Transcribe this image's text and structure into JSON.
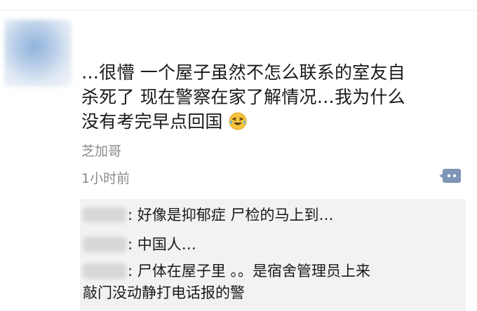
{
  "post": {
    "text_lines": [
      "…很懵 一个屋子虽然不怎么联系的室友自",
      "杀死了 现在警察在家了解情况…我为什么",
      "没有考完早点回国"
    ],
    "emoji": "laughing-crying-emoji",
    "author": "芝加哥",
    "time": "1小时前"
  },
  "replies": [
    {
      "colon": ":",
      "text": "好像是抑郁症 尸检的马上到…"
    },
    {
      "colon": ":",
      "text": "中国人…"
    },
    {
      "colon": ":",
      "text": "尸体在屋子里 。。是宿舍管理员上来",
      "text2": "敲门没动静打电话报的警"
    }
  ],
  "colors": {
    "text": "#1a1a1a",
    "meta": "#8a8a8a",
    "reply_bg": "#f2f2f2",
    "icon_bg": "#7f95b6"
  }
}
